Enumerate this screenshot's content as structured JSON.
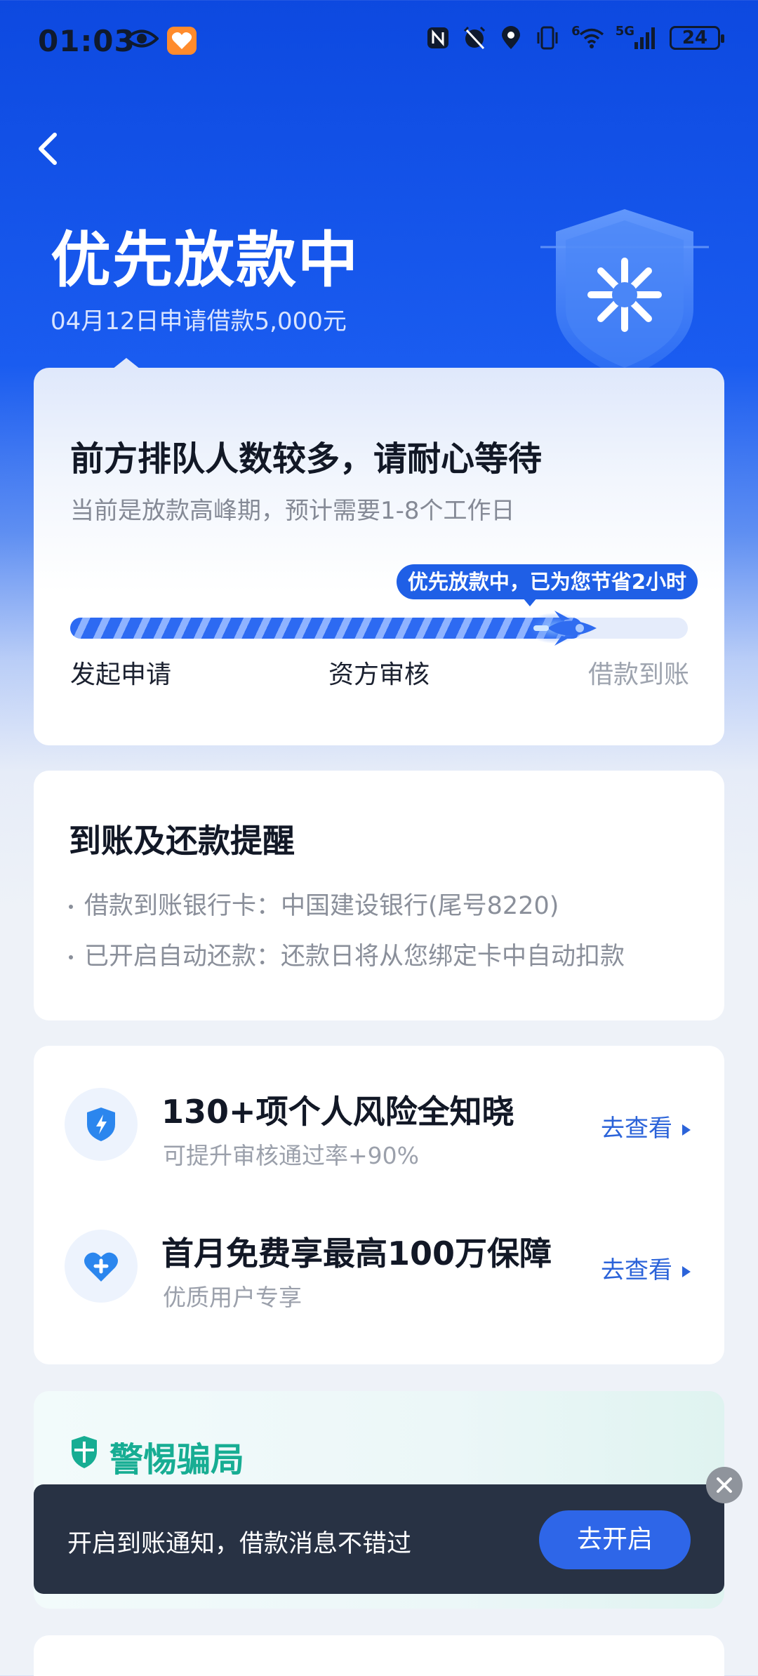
{
  "status_bar": {
    "time": "01:03",
    "battery": "24",
    "signal_label": "5G",
    "wifi_label": "6"
  },
  "header": {
    "title": "优先放款中",
    "subtitle": "04月12日申请借款5,000元"
  },
  "status_card": {
    "title": "前方排队人数较多，请耐心等待",
    "subtitle": "当前是放款高峰期，预计需要1-8个工作日",
    "progress_tip": "优先放款中，已为您节省2小时",
    "progress_percent": 83,
    "steps": [
      "发起申请",
      "资方审核",
      "借款到账"
    ]
  },
  "reminder_card": {
    "title": "到账及还款提醒",
    "lines": [
      "借款到账银行卡：中国建设银行(尾号8220)",
      "已开启自动还款：还款日将从您绑定卡中自动扣款"
    ]
  },
  "services": [
    {
      "title": "130+项个人风险全知晓",
      "subtitle": "可提升审核通过率+90%",
      "link": "去查看",
      "icon": "shield-bolt-icon"
    },
    {
      "title": "首月免费享最高100万保障",
      "subtitle": "优质用户专享",
      "link": "去查看",
      "icon": "heart-plus-icon"
    }
  ],
  "fraud_card": {
    "title": "警惕骗局"
  },
  "toast": {
    "text": "开启到账通知，借款消息不错过",
    "button": "去开启"
  },
  "colors": {
    "brand_blue": "#1a5cf0",
    "accent_green": "#17ad93",
    "toast_bg": "#283244"
  }
}
